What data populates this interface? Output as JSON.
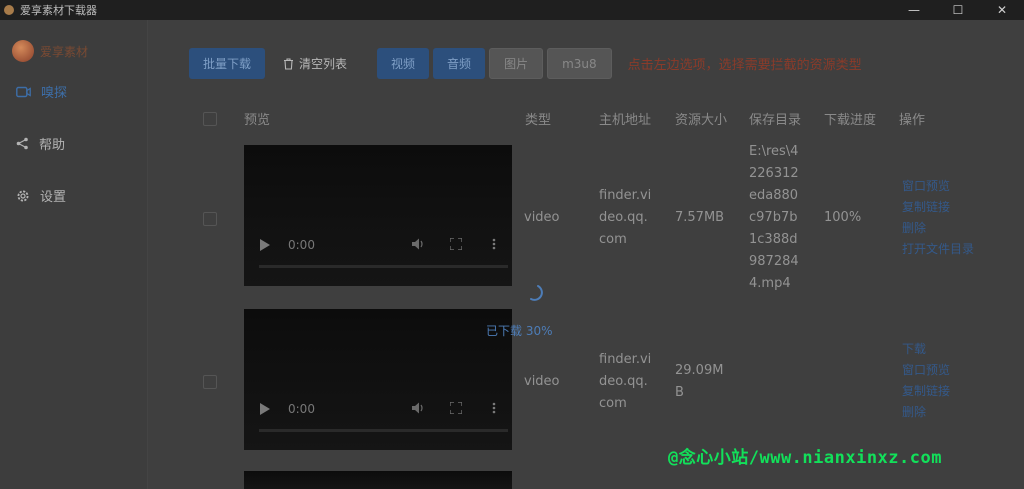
{
  "window": {
    "title": "爱享素材下载器",
    "controls": [
      "—",
      "☐",
      "✕"
    ]
  },
  "sidebar": {
    "username": "爱享素材",
    "items": [
      {
        "label": "嗅探",
        "icon": "video-icon",
        "active": true
      },
      {
        "label": "帮助",
        "icon": "share-icon",
        "active": false
      },
      {
        "label": "设置",
        "icon": "gear-icon",
        "active": false
      }
    ]
  },
  "toolbar": {
    "batch_download": "批量下载",
    "clear_list": "清空列表",
    "type_filters": [
      {
        "label": "视频",
        "selected": true
      },
      {
        "label": "音频",
        "selected": true
      },
      {
        "label": "图片",
        "selected": false
      },
      {
        "label": "m3u8",
        "selected": false
      }
    ],
    "hint": "点击左边选项，选择需要拦截的资源类型"
  },
  "table": {
    "headers": {
      "preview": "预览",
      "type": "类型",
      "host": "主机地址",
      "size": "资源大小",
      "save_dir": "保存目录",
      "progress": "下载进度",
      "actions": "操作"
    },
    "rows": [
      {
        "player_time": "0:00",
        "type": "video",
        "host_lines": [
          "finder.vi",
          "deo.qq.",
          "com"
        ],
        "size_lines": [
          "7.57MB"
        ],
        "dir_lines": [
          "E:\\res\\4",
          "226312",
          "eda880",
          "c97b7b",
          "1c388d",
          "987284",
          "4.mp4"
        ],
        "progress": "100%",
        "actions": [
          "窗口预览",
          "复制链接",
          "删除",
          "打开文件目录"
        ]
      },
      {
        "player_time": "0:00",
        "type": "video",
        "host_lines": [
          "finder.vi",
          "deo.qq.",
          "com"
        ],
        "size_lines": [
          "29.09M",
          "B"
        ],
        "dir_lines": [],
        "progress": "",
        "actions": [
          "下载",
          "窗口预览",
          "复制链接",
          "删除"
        ]
      }
    ]
  },
  "loading": {
    "status": "已下载 30%"
  },
  "watermark": "@念心小站/www.nianxinxz.com",
  "colors": {
    "accent": "#2c4f7c",
    "hint": "#8b3b2a",
    "link": "#34598a",
    "watermark": "#12e05a"
  }
}
